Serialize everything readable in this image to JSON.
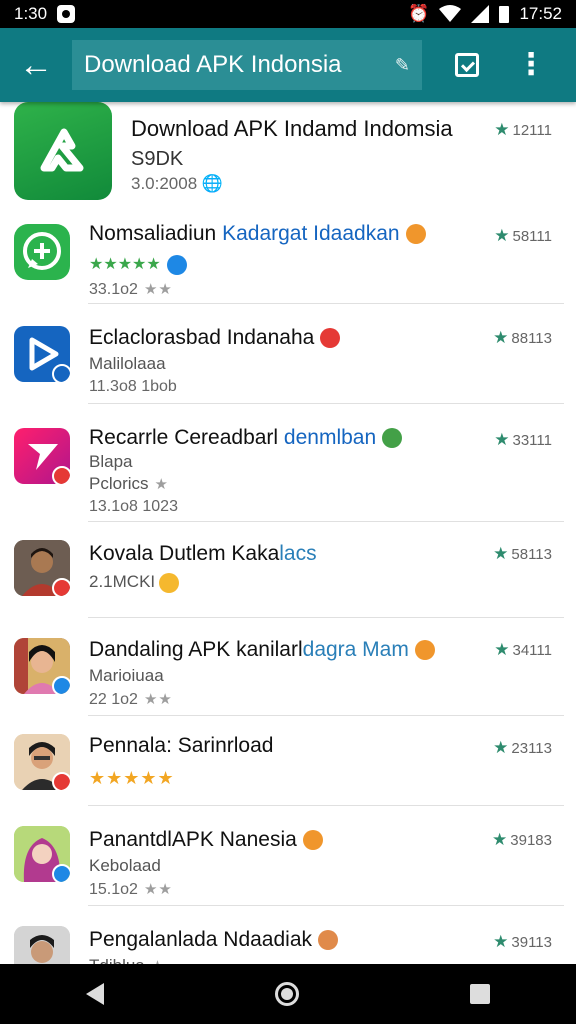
{
  "status": {
    "time_left": "1:30",
    "time_right": "17:52"
  },
  "toolbar": {
    "search_text": "Download APK Indonsia",
    "color": "#0f7a82"
  },
  "featured": {
    "title": "Download APK Indamd Indomsia",
    "subtitle": "S9DK",
    "meta": "3.0:2008",
    "rating": "12111"
  },
  "apps": [
    {
      "title": "Nomsaliadiun ",
      "title_accent": "Kadargat Idaadkan",
      "meta": "33.1o2",
      "rating": "58111",
      "badge_color": "#f0962c"
    },
    {
      "title": "Eclaclorasbad Indanaha",
      "title_accent": "",
      "sub": "Malilolaaa",
      "meta": "11.3o8 1bob",
      "rating": "88113",
      "badge_color": "#e53935"
    },
    {
      "title": "Recarrle Cereadbarl ",
      "title_accent": "denmlban",
      "sub": "Blapa",
      "sub2": "Pclorics",
      "meta": "13.1o8 1023",
      "rating": "33111",
      "badge_color": "#43a047"
    },
    {
      "title": "Kovala Dutlem Kaka",
      "title_accent": "lacs",
      "sub": "2.1MCKI",
      "rating": "58113",
      "badge_color": "#f5b82e"
    },
    {
      "title": "Dandaling APK kanilarl",
      "title_accent": "dagra Mam",
      "sub": "Marioiuaa",
      "meta": "22 1o2",
      "rating": "34111",
      "badge_color": "#f0962c"
    },
    {
      "title": "Pennala: Sarinrload",
      "title_accent": "",
      "rating": "23113"
    },
    {
      "title": "PanantdlAPK Nanesia",
      "title_accent": "",
      "sub": "Kebolaad",
      "meta": "15.1o2",
      "rating": "39183",
      "badge_color": "#f0962c"
    },
    {
      "title": "Pengalanlada Ndaadiak",
      "title_accent": "",
      "sub": "Tdiblua",
      "rating": "39113",
      "badge_color": "#e08a4a"
    }
  ]
}
